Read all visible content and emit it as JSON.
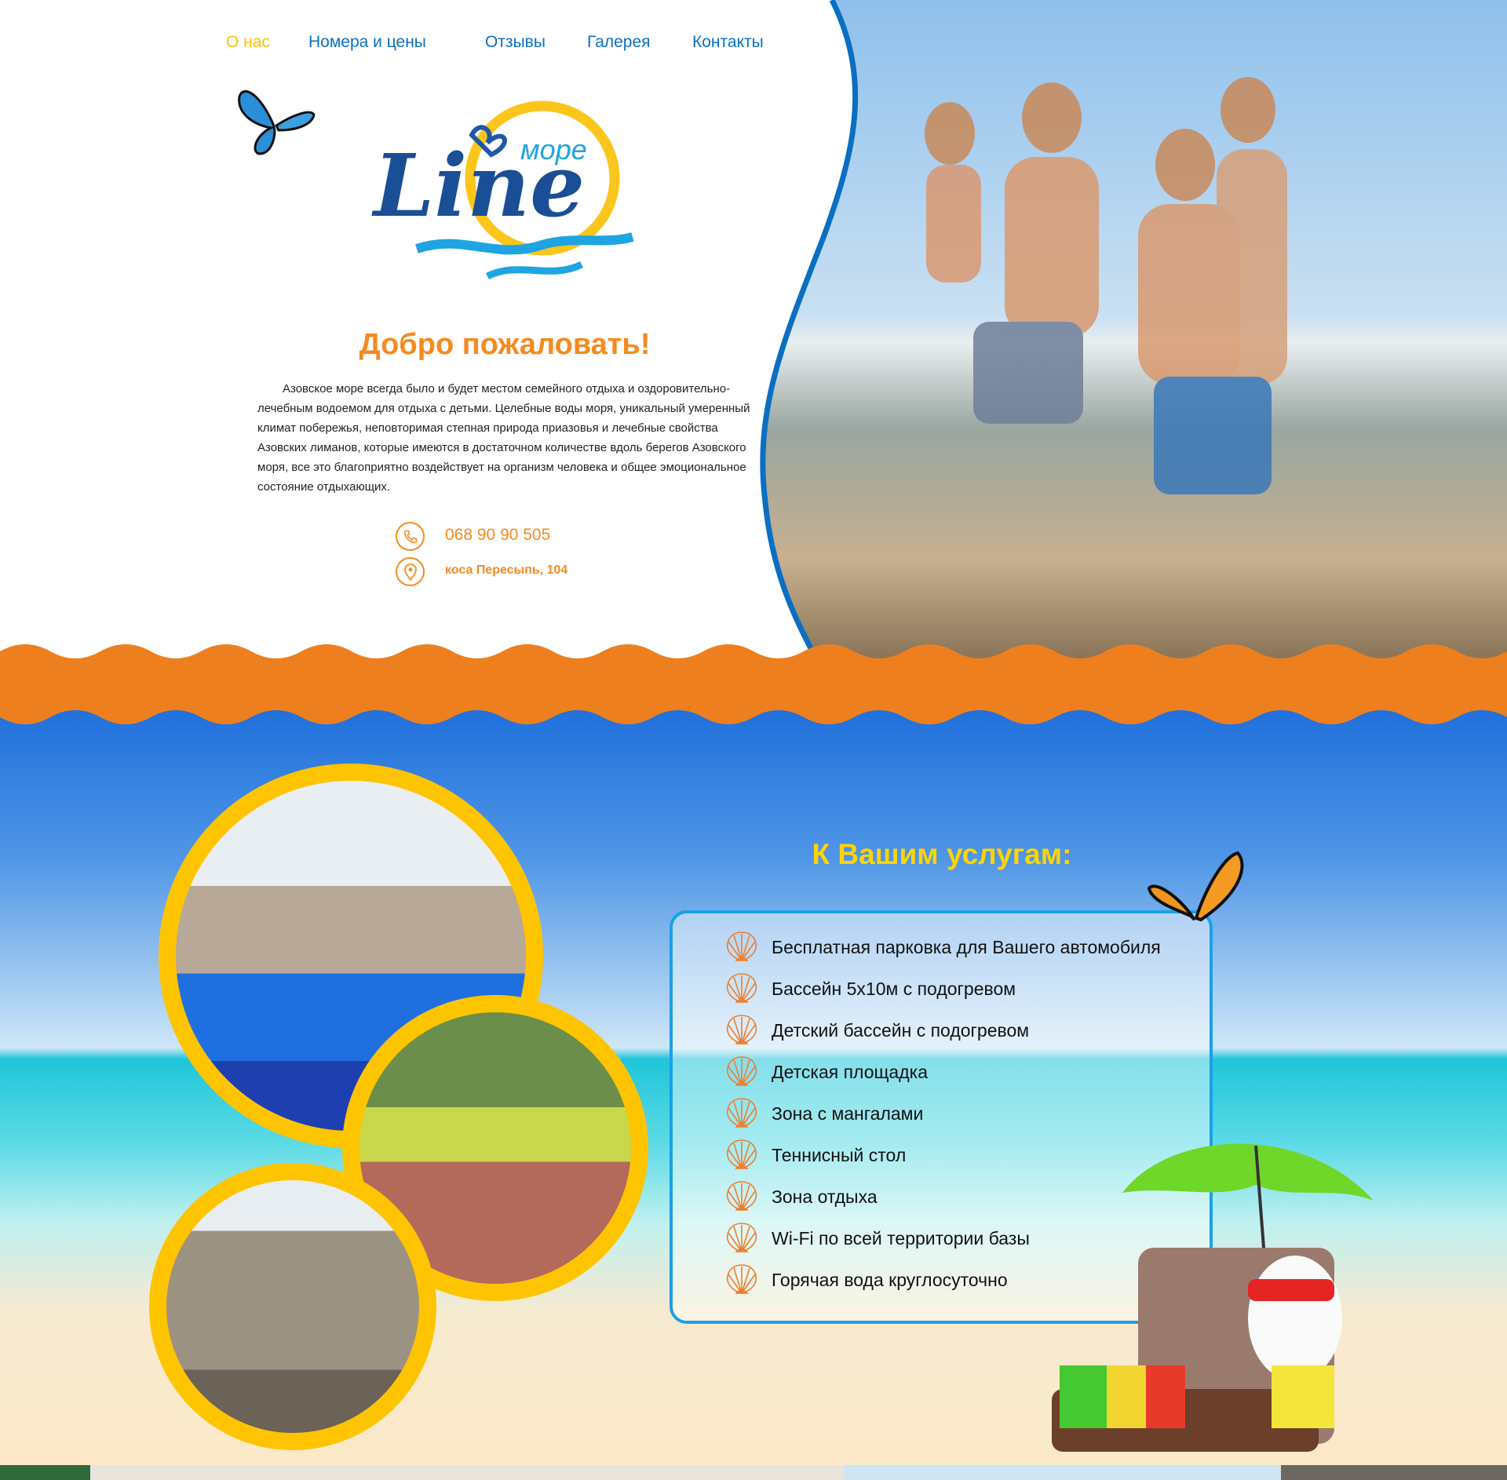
{
  "nav": {
    "items": [
      {
        "label": "О нас",
        "active": true
      },
      {
        "label": "Номера и цены"
      },
      {
        "label": "Отзывы"
      },
      {
        "label": "Галерея"
      },
      {
        "label": "Контакты"
      }
    ]
  },
  "logo": {
    "word": "Line",
    "sub": "море"
  },
  "welcome": {
    "title": "Добро пожаловать!",
    "text": "Азовское море всегда было и будет местом семейного отдыха и оздоровительно-лечебным водоемом для отдыха с детьми. Целебные воды моря, уникальный умеренный климат побережья, неповторимая степная природа приазовья и лечебные свойства Азовских лиманов, которые имеются в достаточном количестве вдоль берегов Азовского моря, все это благоприятно воздействует на организм человека и общее эмоциональное состояние отдыхающих."
  },
  "contacts": {
    "phone": "068 90 90 505",
    "phone_icon": "phone-icon",
    "address": "коса Пересыпь, 104",
    "address_icon": "map-pin-icon"
  },
  "services": {
    "title": "К Вашим услугам:",
    "icon": "seashell-icon",
    "items": [
      "Бесплатная парковка для Вашего автомобиля",
      "Бассейн  5х10м с подогревом",
      "Детский бассейн с подогревом",
      "Детская площадка",
      "Зона с мангалами",
      "Теннисный стол",
      "Зона отдыха",
      "Wi-Fi по всей территории базы",
      "Горячая вода круглосуточно"
    ]
  },
  "colors": {
    "accent_orange": "#f58a1f",
    "nav_blue": "#0a6fc2",
    "yellow": "#ffd400",
    "frame_blue": "#1aa0e8"
  }
}
